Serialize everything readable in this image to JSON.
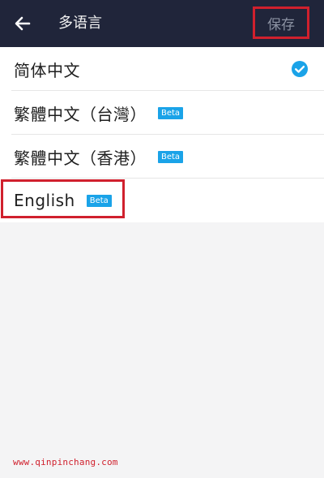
{
  "header": {
    "title": "多语言",
    "save_label": "保存"
  },
  "languages": [
    {
      "label": "简体中文",
      "beta": "",
      "selected": true
    },
    {
      "label": "繁體中文（台灣）",
      "beta": "Beta",
      "selected": false
    },
    {
      "label": "繁體中文（香港）",
      "beta": "Beta",
      "selected": false
    },
    {
      "label": "English",
      "beta": "Beta",
      "selected": false
    }
  ],
  "watermark": "www.qinpinchang.com",
  "colors": {
    "header_bg": "#20253a",
    "accent_blue": "#1aa3e8",
    "highlight_red": "#d0202d"
  },
  "icons": {
    "back": "arrow-left-icon",
    "selected": "check-circle-icon"
  }
}
